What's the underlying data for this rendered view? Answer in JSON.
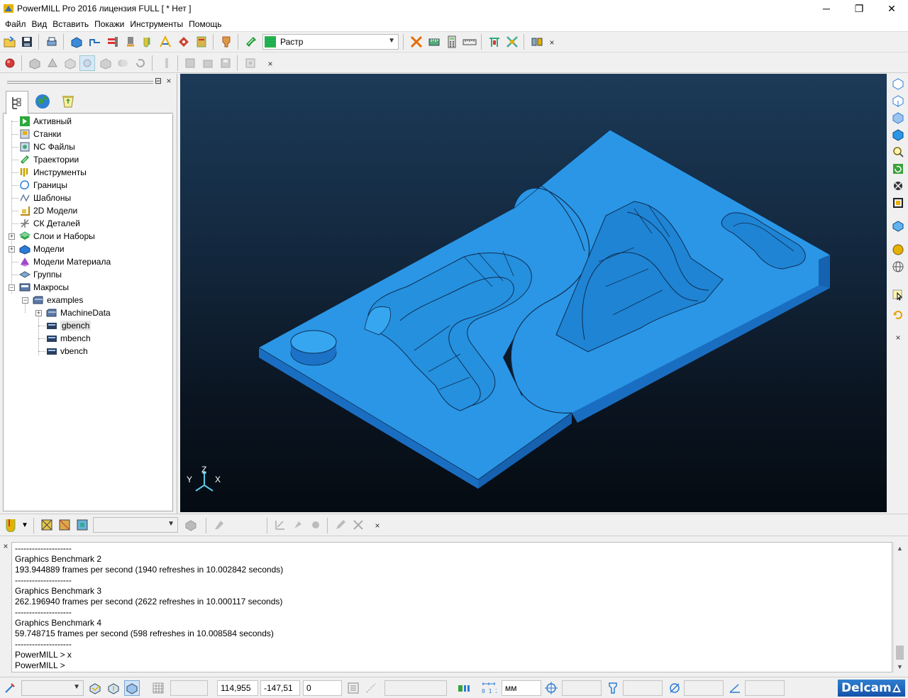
{
  "window": {
    "title": "PowerMILL Pro 2016 лицензия FULL     [ * Нет ]",
    "minimize": "─",
    "restore": "❐",
    "close": "✕"
  },
  "menu": [
    "Файл",
    "Вид",
    "Вставить",
    "Покажи",
    "Инструменты",
    "Помощь"
  ],
  "toolbar": {
    "shading_mode": "Растр",
    "close": "×"
  },
  "toolbar2": {
    "close": "×"
  },
  "explorer": {
    "close": "×",
    "pin": "⊟",
    "tabs": [
      "tree-tab",
      "globe-tab",
      "recycle-tab"
    ],
    "items": [
      {
        "label": "Активный",
        "icon": "active-icon",
        "level": 0,
        "expander": ""
      },
      {
        "label": "Станки",
        "icon": "machine-icon",
        "level": 0,
        "expander": ""
      },
      {
        "label": "NC Файлы",
        "icon": "ncfile-icon",
        "level": 0,
        "expander": ""
      },
      {
        "label": "Траектории",
        "icon": "toolpath-icon",
        "level": 0,
        "expander": ""
      },
      {
        "label": "Инструменты",
        "icon": "tools-icon",
        "level": 0,
        "expander": ""
      },
      {
        "label": "Границы",
        "icon": "boundary-icon",
        "level": 0,
        "expander": ""
      },
      {
        "label": "Шаблоны",
        "icon": "pattern-icon",
        "level": 0,
        "expander": ""
      },
      {
        "label": "2D Модели",
        "icon": "2d-model-icon",
        "level": 0,
        "expander": ""
      },
      {
        "label": "СК Деталей",
        "icon": "workplane-icon",
        "level": 0,
        "expander": ""
      },
      {
        "label": "Слои и Наборы",
        "icon": "layers-icon",
        "level": 0,
        "expander": "+"
      },
      {
        "label": "Модели",
        "icon": "models-icon",
        "level": 0,
        "expander": "+"
      },
      {
        "label": "Модели Материала",
        "icon": "stock-model-icon",
        "level": 0,
        "expander": ""
      },
      {
        "label": "Группы",
        "icon": "groups-icon",
        "level": 0,
        "expander": ""
      },
      {
        "label": "Макросы",
        "icon": "macros-icon",
        "level": 0,
        "expander": "−"
      },
      {
        "label": "examples",
        "icon": "folder-icon",
        "level": 1,
        "expander": "−"
      },
      {
        "label": "MachineData",
        "icon": "folder-icon",
        "level": 2,
        "expander": "+"
      },
      {
        "label": "gbench",
        "icon": "macro-file-icon",
        "level": 2,
        "expander": "",
        "selected": true
      },
      {
        "label": "mbench",
        "icon": "macro-file-icon",
        "level": 2,
        "expander": ""
      },
      {
        "label": "vbench",
        "icon": "macro-file-icon",
        "level": 2,
        "expander": ""
      }
    ]
  },
  "viewport": {
    "axis_x": "X",
    "axis_y": "Y",
    "axis_z": "Z",
    "model_color": "#2b96e6"
  },
  "toolbar3": {
    "close": "×"
  },
  "console": {
    "close": "×",
    "lines": [
      "--------------------",
      "Graphics Benchmark 2",
      "193.944889 frames per second (1940 refreshes in 10.002842 seconds)",
      "--------------------",
      "Graphics Benchmark 3",
      "262.196940 frames per second (2622 refreshes in 10.000117 seconds)",
      "--------------------",
      "Graphics Benchmark 4",
      "59.748715 frames per second (598 refreshes in 10.008584 seconds)",
      "--------------------",
      "PowerMILL > x",
      "PowerMILL >"
    ]
  },
  "status": {
    "x": "114,955",
    "y": "-147,51",
    "z": "0",
    "units": "мм",
    "brand": "Delcam"
  }
}
